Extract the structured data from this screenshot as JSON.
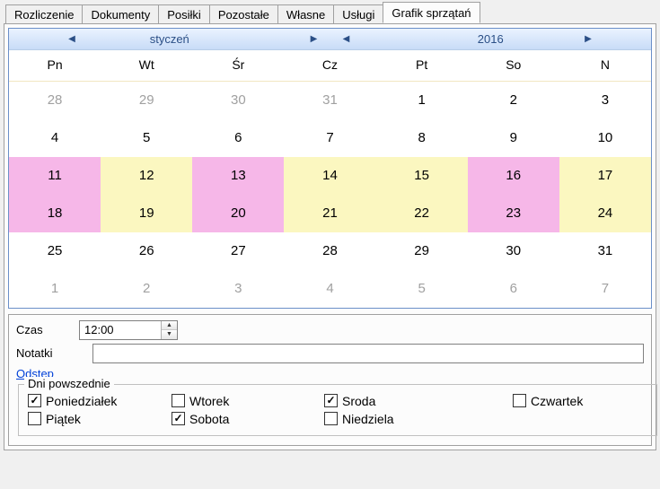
{
  "tabs": {
    "items": [
      {
        "label": "Rozliczenie"
      },
      {
        "label": "Dokumenty"
      },
      {
        "label": "Posiłki"
      },
      {
        "label": "Pozostałe"
      },
      {
        "label": "Własne"
      },
      {
        "label": "Usługi"
      },
      {
        "label": "Grafik sprzątań"
      }
    ],
    "active_index": 6
  },
  "calendar": {
    "month_label": "styczeń",
    "year_label": "2016",
    "day_headers": [
      "Pn",
      "Wt",
      "Śr",
      "Cz",
      "Pt",
      "So",
      "N"
    ],
    "rows": [
      [
        {
          "d": "28",
          "cls": "other"
        },
        {
          "d": "29",
          "cls": "other"
        },
        {
          "d": "30",
          "cls": "other"
        },
        {
          "d": "31",
          "cls": "other"
        },
        {
          "d": "1",
          "cls": ""
        },
        {
          "d": "2",
          "cls": ""
        },
        {
          "d": "3",
          "cls": ""
        }
      ],
      [
        {
          "d": "4",
          "cls": ""
        },
        {
          "d": "5",
          "cls": ""
        },
        {
          "d": "6",
          "cls": ""
        },
        {
          "d": "7",
          "cls": ""
        },
        {
          "d": "8",
          "cls": ""
        },
        {
          "d": "9",
          "cls": ""
        },
        {
          "d": "10",
          "cls": ""
        }
      ],
      [
        {
          "d": "11",
          "cls": "pink"
        },
        {
          "d": "12",
          "cls": "yellow"
        },
        {
          "d": "13",
          "cls": "pink"
        },
        {
          "d": "14",
          "cls": "yellow"
        },
        {
          "d": "15",
          "cls": "yellow"
        },
        {
          "d": "16",
          "cls": "pink"
        },
        {
          "d": "17",
          "cls": "yellow"
        }
      ],
      [
        {
          "d": "18",
          "cls": "pink"
        },
        {
          "d": "19",
          "cls": "yellow"
        },
        {
          "d": "20",
          "cls": "pink"
        },
        {
          "d": "21",
          "cls": "yellow"
        },
        {
          "d": "22",
          "cls": "yellow"
        },
        {
          "d": "23",
          "cls": "pink"
        },
        {
          "d": "24",
          "cls": "yellow"
        }
      ],
      [
        {
          "d": "25",
          "cls": ""
        },
        {
          "d": "26",
          "cls": ""
        },
        {
          "d": "27",
          "cls": ""
        },
        {
          "d": "28",
          "cls": ""
        },
        {
          "d": "29",
          "cls": ""
        },
        {
          "d": "30",
          "cls": ""
        },
        {
          "d": "31",
          "cls": ""
        }
      ],
      [
        {
          "d": "1",
          "cls": "other"
        },
        {
          "d": "2",
          "cls": "other"
        },
        {
          "d": "3",
          "cls": "other"
        },
        {
          "d": "4",
          "cls": "other"
        },
        {
          "d": "5",
          "cls": "other"
        },
        {
          "d": "6",
          "cls": "other"
        },
        {
          "d": "7",
          "cls": "other"
        }
      ]
    ]
  },
  "form": {
    "time_label": "Czas",
    "time_value": "12:00",
    "notes_label": "Notatki",
    "notes_value": "",
    "interval_link": "Odstęp"
  },
  "weekdays": {
    "group_title": "Dni powszednie",
    "row1": [
      {
        "label": "Poniedziałek",
        "checked": true
      },
      {
        "label": "Wtorek",
        "checked": false
      },
      {
        "label": "Sroda",
        "checked": true
      },
      {
        "label": "Czwartek",
        "checked": false
      }
    ],
    "row2": [
      {
        "label": "Piątek",
        "checked": false
      },
      {
        "label": "Sobota",
        "checked": true
      },
      {
        "label": "Niedziela",
        "checked": false
      }
    ]
  }
}
